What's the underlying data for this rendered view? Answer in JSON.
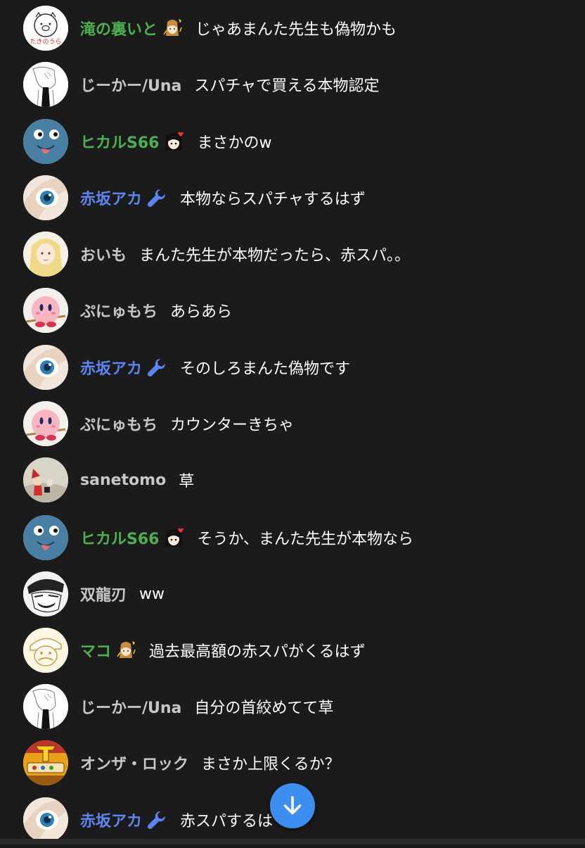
{
  "messages": [
    {
      "author": "滝の裏いと",
      "text": "じゃあまんた先生も偽物かも",
      "role": "member",
      "badge": "member-badge-icon",
      "avatar": "pig-avatar"
    },
    {
      "author": "じーかー/Una",
      "text": "スパチャで買える本物認定",
      "role": "viewer",
      "badge": "",
      "avatar": "sketch-avatar"
    },
    {
      "author": "ヒカルS66",
      "text": "まさかのw",
      "role": "member",
      "badge": "member-girl-badge-icon",
      "avatar": "blue-face-avatar"
    },
    {
      "author": "赤坂アカ",
      "text": "本物ならスパチャするはず",
      "role": "moderator",
      "badge": "wrench-icon",
      "avatar": "eye-avatar"
    },
    {
      "author": "おいも",
      "text": "まんた先生が本物だったら、赤スパ。。",
      "role": "viewer",
      "badge": "",
      "avatar": "blonde-girl-avatar"
    },
    {
      "author": "ぷにゅもち",
      "text": "あらあら",
      "role": "viewer",
      "badge": "",
      "avatar": "kirby-avatar"
    },
    {
      "author": "赤坂アカ",
      "text": "そのしろまんた偽物です",
      "role": "moderator",
      "badge": "wrench-icon",
      "avatar": "eye-avatar"
    },
    {
      "author": "ぷにゅもち",
      "text": "カウンターきちゃ",
      "role": "viewer",
      "badge": "",
      "avatar": "kirby-avatar"
    },
    {
      "author": "sanetomo",
      "text": "草",
      "role": "viewer",
      "badge": "",
      "avatar": "figure-avatar"
    },
    {
      "author": "ヒカルS66",
      "text": "そうか、まんた先生が本物なら",
      "role": "member",
      "badge": "member-girl-badge-icon",
      "avatar": "blue-face-avatar"
    },
    {
      "author": "双龍刃",
      "text": "ww",
      "role": "viewer",
      "badge": "",
      "avatar": "manga-face-avatar"
    },
    {
      "author": "マコ",
      "text": "過去最高額の赤スパがくるはず",
      "role": "member",
      "badge": "member-badge-icon",
      "avatar": "mario-avatar"
    },
    {
      "author": "じーかー/Una",
      "text": "自分の首絞めてて草",
      "role": "viewer",
      "badge": "",
      "avatar": "sketch-avatar"
    },
    {
      "author": "オンザ・ロック",
      "text": "まさか上限くるか？",
      "role": "viewer",
      "badge": "",
      "avatar": "logo-avatar"
    },
    {
      "author": "赤坂アカ",
      "text": "赤スパするは",
      "role": "moderator",
      "badge": "wrench-icon",
      "avatar": "eye-avatar"
    }
  ],
  "fab": {
    "icon": "arrow-down-icon"
  },
  "colors": {
    "background": "#1b1b1b",
    "member": "#4caf50",
    "moderator": "#5e84f1",
    "viewer": "#c7c7c7",
    "fab": "#3e8df0"
  }
}
